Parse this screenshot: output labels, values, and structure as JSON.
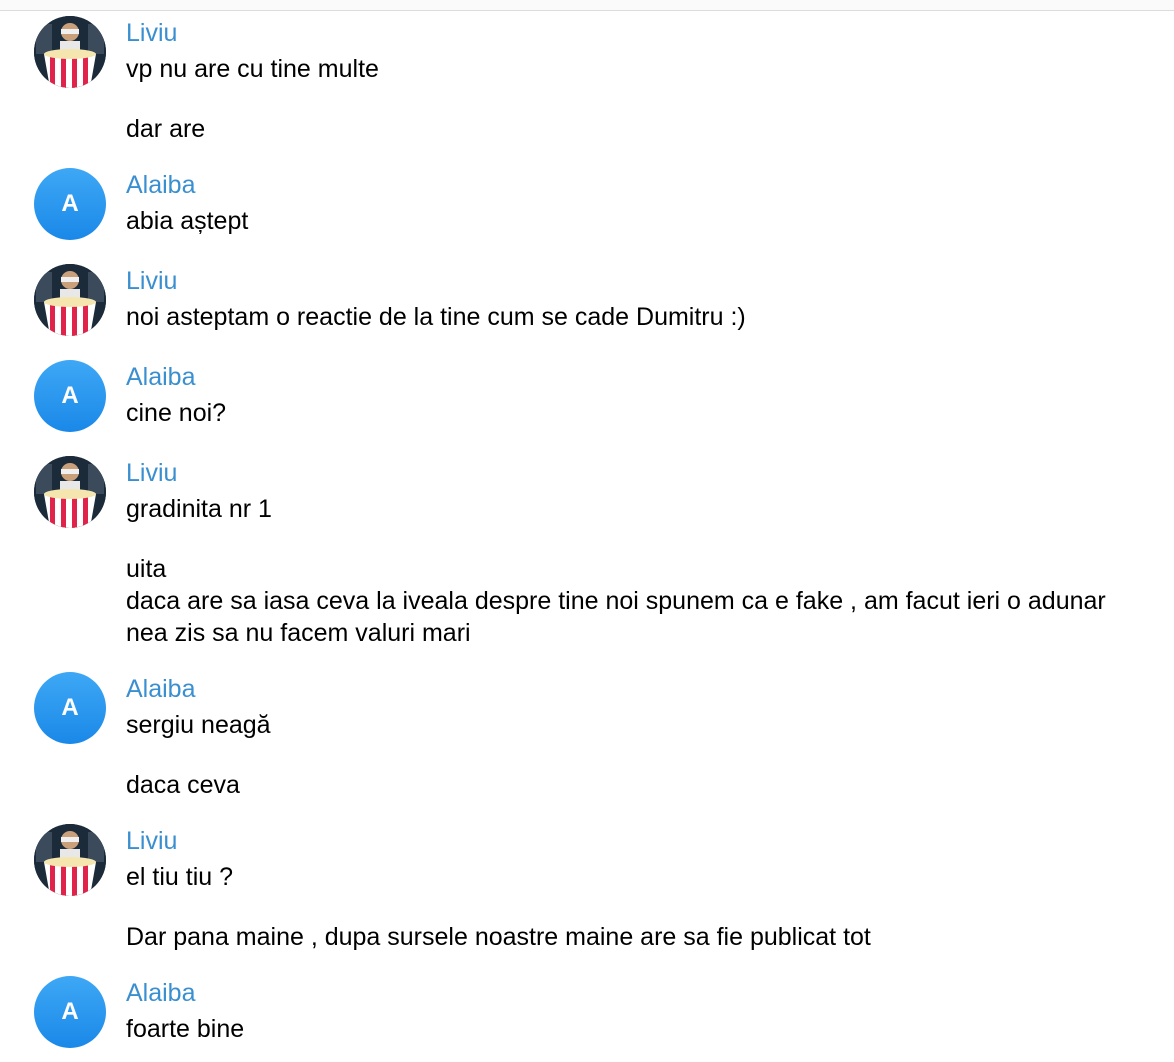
{
  "colors": {
    "sender_name": "#3a8fd0",
    "avatar_letter_bg": "#2196f3",
    "message_text": "#000000"
  },
  "messages": [
    {
      "sender": "Liviu",
      "avatar": "popcorn-photo",
      "lines": [
        "vp nu are cu tine multe"
      ]
    },
    {
      "lines": [
        "dar are"
      ]
    },
    {
      "sender": "Alaiba",
      "avatar_letter": "A",
      "lines": [
        "abia aștept"
      ]
    },
    {
      "sender": "Liviu",
      "avatar": "popcorn-photo",
      "lines": [
        "noi asteptam o reactie de la tine cum se cade Dumitru :)"
      ]
    },
    {
      "sender": "Alaiba",
      "avatar_letter": "A",
      "lines": [
        "cine noi?"
      ]
    },
    {
      "sender": "Liviu",
      "avatar": "popcorn-photo",
      "lines": [
        "gradinita nr 1"
      ]
    },
    {
      "lines": [
        "uita",
        "daca are sa iasa ceva la iveala despre tine noi spunem ca e fake , am facut ieri o adunar",
        "nea zis sa nu facem valuri mari"
      ]
    },
    {
      "sender": "Alaiba",
      "avatar_letter": "A",
      "lines": [
        "sergiu neagă"
      ]
    },
    {
      "lines": [
        "daca ceva"
      ]
    },
    {
      "sender": "Liviu",
      "avatar": "popcorn-photo",
      "lines": [
        "el tiu tiu ?"
      ]
    },
    {
      "lines": [
        "Dar pana maine , dupa sursele noastre maine are sa fie publicat tot"
      ]
    },
    {
      "sender": "Alaiba",
      "avatar_letter": "A",
      "lines": [
        "foarte bine"
      ]
    }
  ]
}
